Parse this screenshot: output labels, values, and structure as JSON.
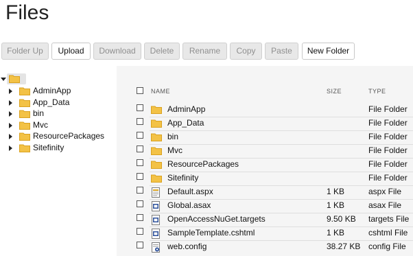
{
  "page": {
    "title": "Files"
  },
  "toolbar": {
    "folder_up": "Folder Up",
    "upload": "Upload",
    "download": "Download",
    "delete": "Delete",
    "rename": "Rename",
    "copy": "Copy",
    "paste": "Paste",
    "new_folder": "New Folder"
  },
  "tree": {
    "items": [
      {
        "label": "AdminApp"
      },
      {
        "label": "App_Data"
      },
      {
        "label": "bin"
      },
      {
        "label": "Mvc"
      },
      {
        "label": "ResourcePackages"
      },
      {
        "label": "Sitefinity"
      }
    ]
  },
  "table": {
    "columns": {
      "name": "NAME",
      "size": "SIZE",
      "type": "TYPE"
    },
    "rows": [
      {
        "name": "AdminApp",
        "size": "",
        "type": "File Folder",
        "icon": "folder-icon"
      },
      {
        "name": "App_Data",
        "size": "",
        "type": "File Folder",
        "icon": "folder-icon"
      },
      {
        "name": "bin",
        "size": "",
        "type": "File Folder",
        "icon": "folder-icon"
      },
      {
        "name": "Mvc",
        "size": "",
        "type": "File Folder",
        "icon": "folder-icon"
      },
      {
        "name": "ResourcePackages",
        "size": "",
        "type": "File Folder",
        "icon": "folder-icon"
      },
      {
        "name": "Sitefinity",
        "size": "",
        "type": "File Folder",
        "icon": "folder-icon"
      },
      {
        "name": "Default.aspx",
        "size": "1 KB",
        "type": "aspx File",
        "icon": "aspx-file-icon"
      },
      {
        "name": "Global.asax",
        "size": "1 KB",
        "type": "asax File",
        "icon": "asax-file-icon"
      },
      {
        "name": "OpenAccessNuGet.targets",
        "size": "9.50 KB",
        "type": "targets File",
        "icon": "targets-file-icon"
      },
      {
        "name": "SampleTemplate.cshtml",
        "size": "1 KB",
        "type": "cshtml File",
        "icon": "cshtml-file-icon"
      },
      {
        "name": "web.config",
        "size": "38.27 KB",
        "type": "config File",
        "icon": "config-file-icon"
      }
    ]
  },
  "colors": {
    "folder": "#f3c246",
    "folder_dark": "#d9a11f",
    "disabled_button_bg": "#e8e8e8",
    "panel_bg": "#f5f5f5",
    "file_icon_blue": "#2b4f9a"
  }
}
